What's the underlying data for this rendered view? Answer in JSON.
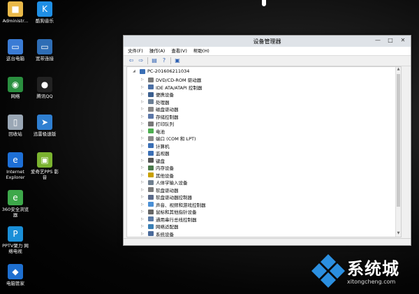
{
  "desktop": {
    "icons": [
      {
        "name": "administrator-folder",
        "label": "Administr...",
        "color": "#e9b949",
        "glyph": "■"
      },
      {
        "name": "kugou-music",
        "label": "酷狗音乐",
        "color": "#1f8fe5",
        "glyph": "K"
      },
      {
        "name": "this-pc",
        "label": "这台电脑",
        "color": "#3a7bd5",
        "glyph": "▭"
      },
      {
        "name": "broadband",
        "label": "宽带连接",
        "color": "#2e6db5",
        "glyph": "▭"
      },
      {
        "name": "network",
        "label": "网络",
        "color": "#2a8f3f",
        "glyph": "◉"
      },
      {
        "name": "tencent-qq",
        "label": "腾讯QQ",
        "color": "#222",
        "glyph": "●"
      },
      {
        "name": "recycle-bin",
        "label": "回收站",
        "color": "#9aa7b5",
        "glyph": "▯"
      },
      {
        "name": "xunlei",
        "label": "迅雷极速版",
        "color": "#2f7fd1",
        "glyph": "➤"
      },
      {
        "name": "internet-explorer",
        "label": "Internet Explorer",
        "color": "#1d6fd6",
        "glyph": "e"
      },
      {
        "name": "iqiyi-pps",
        "label": "爱奇艺PPS 影音",
        "color": "#7ab32f",
        "glyph": "▣"
      },
      {
        "name": "360-browser",
        "label": "360安全浏览器",
        "color": "#3da84a",
        "glyph": "e"
      },
      {
        "name": "pptv",
        "label": "PPTV聚力 网络电视",
        "color": "#1a8fd8",
        "glyph": "P"
      },
      {
        "name": "pc-manager",
        "label": "电脑管家",
        "color": "#1e6fd0",
        "glyph": "◆"
      }
    ]
  },
  "window": {
    "title": "设备管理器",
    "controls": {
      "minimize": "—",
      "maximize": "□",
      "close": "✕"
    },
    "menu": [
      "文件(F)",
      "操作(A)",
      "查看(V)",
      "帮助(H)"
    ],
    "toolbar": [
      "back",
      "forward",
      "sep",
      "properties",
      "help",
      "sep",
      "update"
    ],
    "root": "PC-201606211034",
    "devices": [
      {
        "label": "DVD/CD-ROM 驱动器",
        "color": "#7a7a7a"
      },
      {
        "label": "IDE ATA/ATAPI 控制器",
        "color": "#4a6fa5"
      },
      {
        "label": "便携设备",
        "color": "#3b5f8f"
      },
      {
        "label": "处理器",
        "color": "#6b7f95"
      },
      {
        "label": "磁盘驱动器",
        "color": "#888888"
      },
      {
        "label": "存储控制器",
        "color": "#5b77a8"
      },
      {
        "label": "打印队列",
        "color": "#777777"
      },
      {
        "label": "电池",
        "color": "#4caf50"
      },
      {
        "label": "端口 (COM 和 LPT)",
        "color": "#8a8a8a"
      },
      {
        "label": "计算机",
        "color": "#3a6fb5"
      },
      {
        "label": "监视器",
        "color": "#3a6fb5"
      },
      {
        "label": "键盘",
        "color": "#555555"
      },
      {
        "label": "内存设备",
        "color": "#4a7a4a"
      },
      {
        "label": "其他设备",
        "color": "#c8a000"
      },
      {
        "label": "人体学输入设备",
        "color": "#6f7f8f"
      },
      {
        "label": "软盘驱动器",
        "color": "#7a7a7a"
      },
      {
        "label": "软盘驱动器控制器",
        "color": "#5a6a8a"
      },
      {
        "label": "声音、视频和游戏控制器",
        "color": "#4a8fd5"
      },
      {
        "label": "鼠标和其他指针设备",
        "color": "#666666"
      },
      {
        "label": "通用串行总线控制器",
        "color": "#5a7aa5"
      },
      {
        "label": "网络适配器",
        "color": "#3a7fb5"
      },
      {
        "label": "系统设备",
        "color": "#4a6a9a"
      }
    ]
  },
  "watermark": {
    "text": "系统城",
    "url": "xitongcheng.com"
  }
}
